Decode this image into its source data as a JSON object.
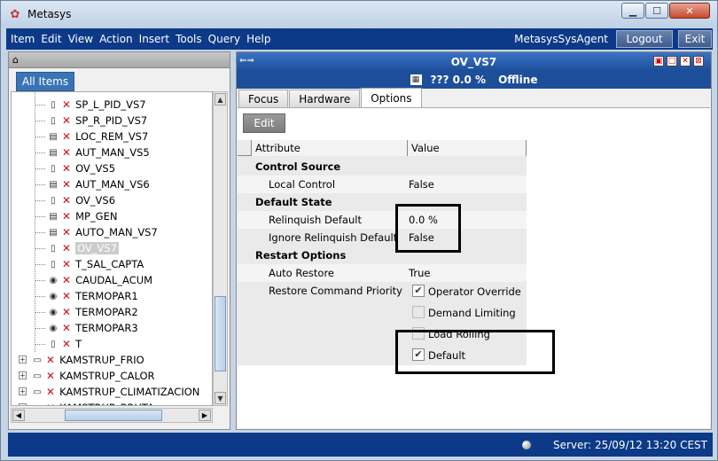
{
  "window": {
    "title": "Metasys",
    "min": "▁",
    "max": "☐",
    "close": "✕"
  },
  "menu": {
    "items": [
      "Item",
      "Edit",
      "View",
      "Action",
      "Insert",
      "Tools",
      "Query",
      "Help"
    ],
    "agent": "MetasysSysAgent",
    "logout": "Logout",
    "exit": "Exit"
  },
  "left": {
    "tab": "All Items",
    "tree": [
      {
        "label": "SP_L_PID_VS7",
        "icon": "analog-point-icon"
      },
      {
        "label": "SP_R_PID_VS7",
        "icon": "analog-point-icon"
      },
      {
        "label": "LOC_REM_VS7",
        "icon": "binary-point-icon"
      },
      {
        "label": "AUT_MAN_VS5",
        "icon": "binary-point-icon"
      },
      {
        "label": "OV_VS5",
        "icon": "analog-point-icon"
      },
      {
        "label": "AUT_MAN_VS6",
        "icon": "binary-point-icon"
      },
      {
        "label": "OV_VS6",
        "icon": "analog-point-icon"
      },
      {
        "label": "MP_GEN",
        "icon": "binary-point-icon"
      },
      {
        "label": "AUTO_MAN_VS7",
        "icon": "binary-point-icon"
      },
      {
        "label": "OV_VS7",
        "icon": "analog-point-icon"
      },
      {
        "label": "T_SAL_CAPTA",
        "icon": "analog-point-icon"
      },
      {
        "label": "CAUDAL_ACUM",
        "icon": "gauge-icon"
      },
      {
        "label": "TERMOPAR1",
        "icon": "gauge-icon"
      },
      {
        "label": "TERMOPAR2",
        "icon": "gauge-icon"
      },
      {
        "label": "TERMOPAR3",
        "icon": "gauge-icon"
      },
      {
        "label": "T",
        "icon": "analog-point-icon"
      },
      {
        "label": "KAMSTRUP_FRIO",
        "icon": "device-icon"
      },
      {
        "label": "KAMSTRUP_CALOR",
        "icon": "device-icon"
      },
      {
        "label": "KAMSTRUP_CLIMATIZACION",
        "icon": "device-icon"
      },
      {
        "label": "KAMSTRUP_BRUTA",
        "icon": "device-icon"
      }
    ]
  },
  "right": {
    "title": "OV_VS7",
    "present_value": "??? 0.0 %",
    "status": "Offline",
    "tabs": [
      "Focus",
      "Hardware",
      "Options"
    ],
    "edit": "Edit",
    "columns": {
      "attribute": "Attribute",
      "value": "Value"
    },
    "control_source": {
      "section": "Control Source",
      "local_control_label": "Local Control",
      "local_control_value": "False"
    },
    "default_state": {
      "section": "Default State",
      "relinquish_label": "Relinquish Default",
      "relinquish_value": "0.0 %",
      "ignore_label": "Ignore Relinquish Default",
      "ignore_value": "False"
    },
    "restart": {
      "section": "Restart Options",
      "auto_label": "Auto Restore",
      "auto_value": "True",
      "priority_label": "Restore Command Priority",
      "options": [
        {
          "label": "Operator Override",
          "checked": true
        },
        {
          "label": "Demand Limiting",
          "checked": false
        },
        {
          "label": "Load Rolling",
          "checked": false
        },
        {
          "label": "Default",
          "checked": true
        }
      ]
    }
  },
  "footer": {
    "server": "Server: 25/09/12 13:20 CEST"
  }
}
